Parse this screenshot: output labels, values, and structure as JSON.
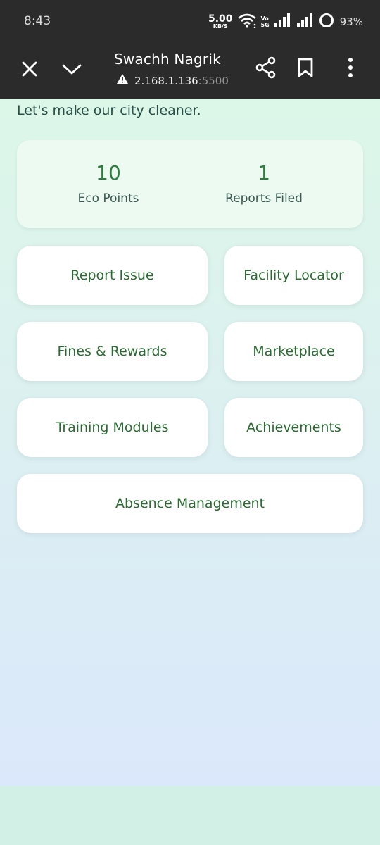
{
  "status": {
    "time": "8:43",
    "net_speed": "5.00",
    "net_unit": "KB/S",
    "volte_top": "Vo",
    "volte_bottom": "5G",
    "battery": "93%"
  },
  "browser": {
    "title": "Swachh Nagrik",
    "url_host": "2.168.1.136",
    "url_port": ":5500",
    "icons": [
      "close-icon",
      "chevron-down-icon",
      "share-icon",
      "bookmark-icon",
      "more-vertical-icon",
      "warning-icon"
    ]
  },
  "page": {
    "tagline": "Let's make our city cleaner.",
    "stats": {
      "eco_points_value": "10",
      "eco_points_label": "Eco Points",
      "reports_value": "1",
      "reports_label": "Reports Filed"
    },
    "tiles": {
      "report_issue": "Report Issue",
      "facility_locator": "Facility Locator",
      "fines_rewards": "Fines & Rewards",
      "marketplace": "Marketplace",
      "training_modules": "Training Modules",
      "achievements": "Achievements",
      "absence_management": "Absence Management"
    }
  },
  "colors": {
    "toolbar_bg": "#2b2b2b",
    "accent_green": "#2e7d3e",
    "tile_text": "#2a6b32",
    "gradient_top": "#dcf7e8",
    "gradient_bottom": "#dbe8fb"
  }
}
